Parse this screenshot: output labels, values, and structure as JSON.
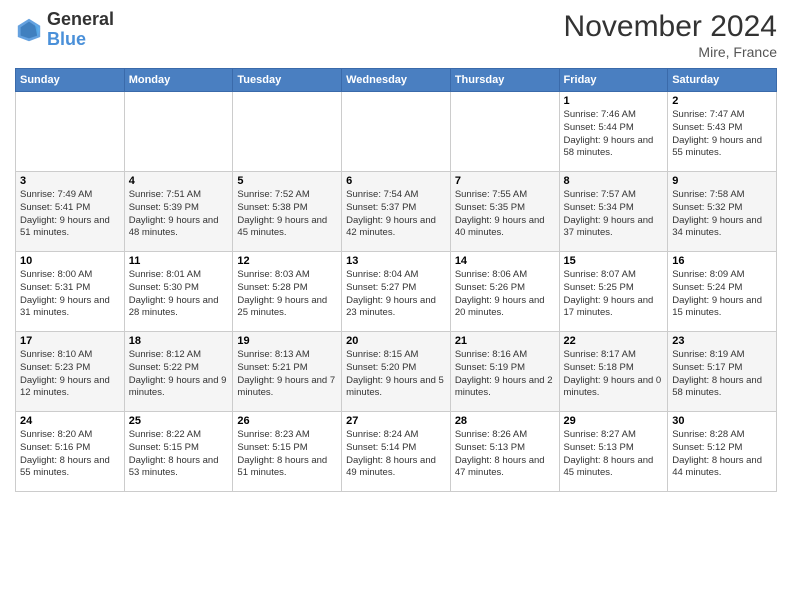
{
  "logo": {
    "text_general": "General",
    "text_blue": "Blue"
  },
  "header": {
    "month_title": "November 2024",
    "location": "Mire, France"
  },
  "weekdays": [
    "Sunday",
    "Monday",
    "Tuesday",
    "Wednesday",
    "Thursday",
    "Friday",
    "Saturday"
  ],
  "weeks": [
    [
      {
        "day": "",
        "info": ""
      },
      {
        "day": "",
        "info": ""
      },
      {
        "day": "",
        "info": ""
      },
      {
        "day": "",
        "info": ""
      },
      {
        "day": "",
        "info": ""
      },
      {
        "day": "1",
        "info": "Sunrise: 7:46 AM\nSunset: 5:44 PM\nDaylight: 9 hours and 58 minutes."
      },
      {
        "day": "2",
        "info": "Sunrise: 7:47 AM\nSunset: 5:43 PM\nDaylight: 9 hours and 55 minutes."
      }
    ],
    [
      {
        "day": "3",
        "info": "Sunrise: 7:49 AM\nSunset: 5:41 PM\nDaylight: 9 hours and 51 minutes."
      },
      {
        "day": "4",
        "info": "Sunrise: 7:51 AM\nSunset: 5:39 PM\nDaylight: 9 hours and 48 minutes."
      },
      {
        "day": "5",
        "info": "Sunrise: 7:52 AM\nSunset: 5:38 PM\nDaylight: 9 hours and 45 minutes."
      },
      {
        "day": "6",
        "info": "Sunrise: 7:54 AM\nSunset: 5:37 PM\nDaylight: 9 hours and 42 minutes."
      },
      {
        "day": "7",
        "info": "Sunrise: 7:55 AM\nSunset: 5:35 PM\nDaylight: 9 hours and 40 minutes."
      },
      {
        "day": "8",
        "info": "Sunrise: 7:57 AM\nSunset: 5:34 PM\nDaylight: 9 hours and 37 minutes."
      },
      {
        "day": "9",
        "info": "Sunrise: 7:58 AM\nSunset: 5:32 PM\nDaylight: 9 hours and 34 minutes."
      }
    ],
    [
      {
        "day": "10",
        "info": "Sunrise: 8:00 AM\nSunset: 5:31 PM\nDaylight: 9 hours and 31 minutes."
      },
      {
        "day": "11",
        "info": "Sunrise: 8:01 AM\nSunset: 5:30 PM\nDaylight: 9 hours and 28 minutes."
      },
      {
        "day": "12",
        "info": "Sunrise: 8:03 AM\nSunset: 5:28 PM\nDaylight: 9 hours and 25 minutes."
      },
      {
        "day": "13",
        "info": "Sunrise: 8:04 AM\nSunset: 5:27 PM\nDaylight: 9 hours and 23 minutes."
      },
      {
        "day": "14",
        "info": "Sunrise: 8:06 AM\nSunset: 5:26 PM\nDaylight: 9 hours and 20 minutes."
      },
      {
        "day": "15",
        "info": "Sunrise: 8:07 AM\nSunset: 5:25 PM\nDaylight: 9 hours and 17 minutes."
      },
      {
        "day": "16",
        "info": "Sunrise: 8:09 AM\nSunset: 5:24 PM\nDaylight: 9 hours and 15 minutes."
      }
    ],
    [
      {
        "day": "17",
        "info": "Sunrise: 8:10 AM\nSunset: 5:23 PM\nDaylight: 9 hours and 12 minutes."
      },
      {
        "day": "18",
        "info": "Sunrise: 8:12 AM\nSunset: 5:22 PM\nDaylight: 9 hours and 9 minutes."
      },
      {
        "day": "19",
        "info": "Sunrise: 8:13 AM\nSunset: 5:21 PM\nDaylight: 9 hours and 7 minutes."
      },
      {
        "day": "20",
        "info": "Sunrise: 8:15 AM\nSunset: 5:20 PM\nDaylight: 9 hours and 5 minutes."
      },
      {
        "day": "21",
        "info": "Sunrise: 8:16 AM\nSunset: 5:19 PM\nDaylight: 9 hours and 2 minutes."
      },
      {
        "day": "22",
        "info": "Sunrise: 8:17 AM\nSunset: 5:18 PM\nDaylight: 9 hours and 0 minutes."
      },
      {
        "day": "23",
        "info": "Sunrise: 8:19 AM\nSunset: 5:17 PM\nDaylight: 8 hours and 58 minutes."
      }
    ],
    [
      {
        "day": "24",
        "info": "Sunrise: 8:20 AM\nSunset: 5:16 PM\nDaylight: 8 hours and 55 minutes."
      },
      {
        "day": "25",
        "info": "Sunrise: 8:22 AM\nSunset: 5:15 PM\nDaylight: 8 hours and 53 minutes."
      },
      {
        "day": "26",
        "info": "Sunrise: 8:23 AM\nSunset: 5:15 PM\nDaylight: 8 hours and 51 minutes."
      },
      {
        "day": "27",
        "info": "Sunrise: 8:24 AM\nSunset: 5:14 PM\nDaylight: 8 hours and 49 minutes."
      },
      {
        "day": "28",
        "info": "Sunrise: 8:26 AM\nSunset: 5:13 PM\nDaylight: 8 hours and 47 minutes."
      },
      {
        "day": "29",
        "info": "Sunrise: 8:27 AM\nSunset: 5:13 PM\nDaylight: 8 hours and 45 minutes."
      },
      {
        "day": "30",
        "info": "Sunrise: 8:28 AM\nSunset: 5:12 PM\nDaylight: 8 hours and 44 minutes."
      }
    ]
  ]
}
